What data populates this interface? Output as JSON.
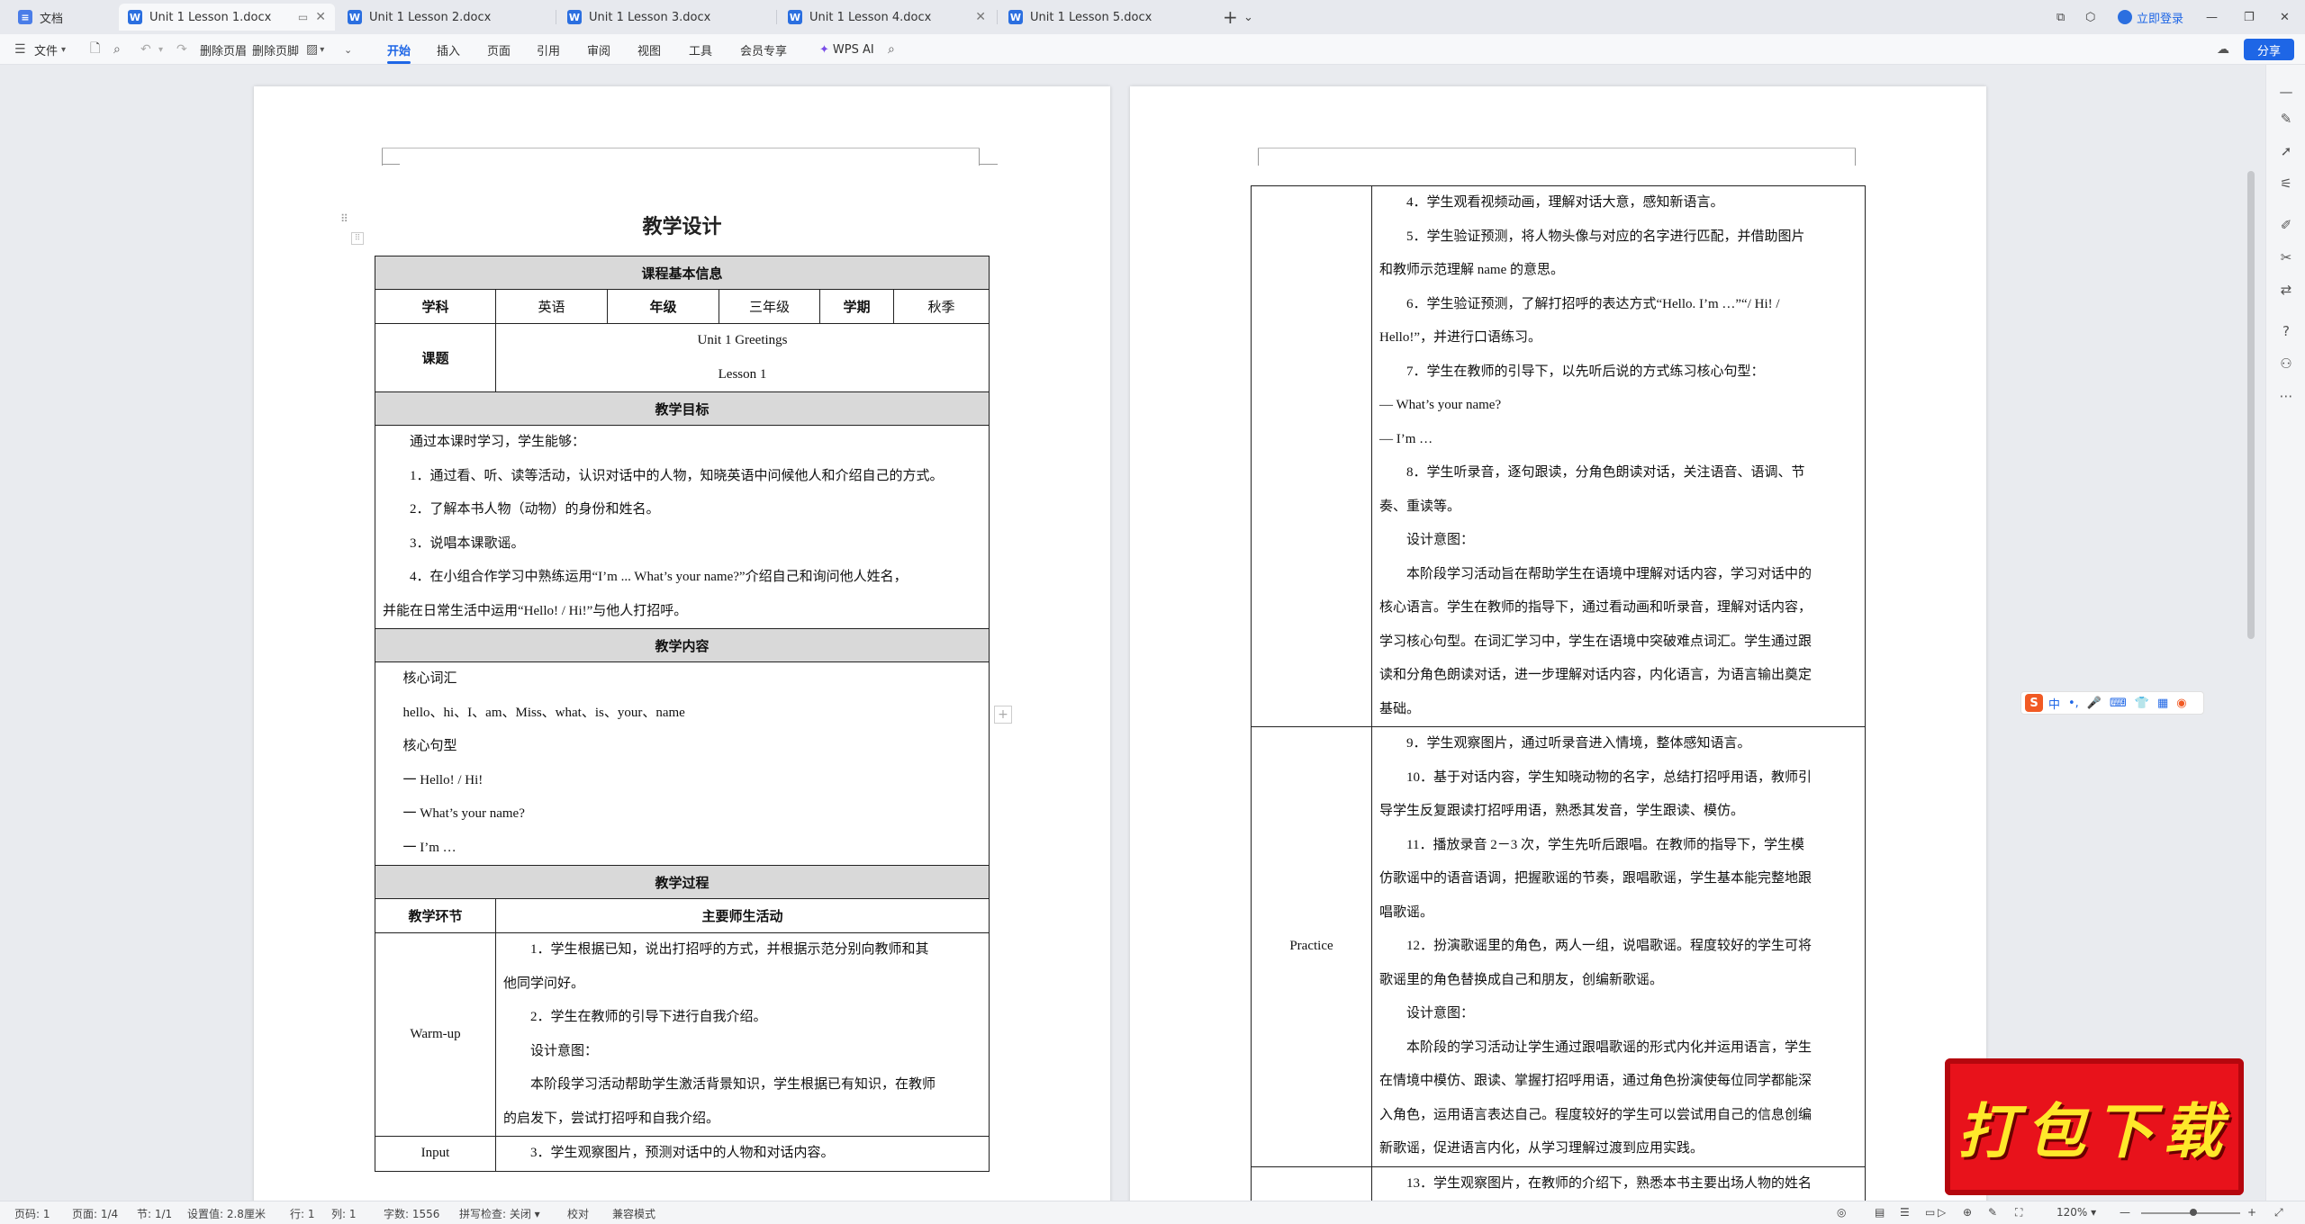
{
  "tabs": [
    {
      "label": "文档",
      "active": false
    },
    {
      "label": "Unit 1 Lesson 1.docx",
      "active": true
    },
    {
      "label": "Unit 1 Lesson 2.docx",
      "active": false
    },
    {
      "label": "Unit 1 Lesson 3.docx",
      "active": false
    },
    {
      "label": "Unit 1 Lesson 4.docx",
      "active": false
    },
    {
      "label": "Unit 1 Lesson 5.docx",
      "active": false
    }
  ],
  "titlebar": {
    "login": "立即登录",
    "share": "分享"
  },
  "ribbon": {
    "file": "文件",
    "delete_blank_page": "删除页眉",
    "delete_header": "删除页脚",
    "menus": [
      "开始",
      "插入",
      "页面",
      "引用",
      "审阅",
      "视图",
      "工具",
      "会员专享"
    ],
    "wps_ai": "WPS AI"
  },
  "page1": {
    "title": "教学设计",
    "basic_info_header": "课程基本信息",
    "subject_label": "学科",
    "subject_value": "英语",
    "grade_label": "年级",
    "grade_value": "三年级",
    "term_label": "学期",
    "term_value": "秋季",
    "topic_label": "课题",
    "topic_line1": "Unit 1 Greetings",
    "topic_line2": "Lesson 1",
    "goals_header": "教学目标",
    "goals": [
      "通过本课时学习，学生能够：",
      "1．通过看、听、读等活动，认识对话中的人物，知晓英语中问候他人和介绍自己的方式。",
      "2．了解本书人物（动物）的身份和姓名。",
      "3．说唱本课歌谣。",
      "4．在小组合作学习中熟练运用“I’m ... What’s your name?”介绍自己和询问他人姓名，",
      "并能在日常生活中运用“Hello! / Hi!”与他人打招呼。"
    ],
    "content_header": "教学内容",
    "vocab_title": "核心词汇",
    "vocab": "hello、hi、I、am、Miss、what、is、your、name",
    "pattern_title": "核心句型",
    "patterns": [
      "一  Hello! / Hi!",
      "一  What’s your name?",
      "一  I’m …"
    ],
    "process_header": "教学过程",
    "stage_col": "教学环节",
    "activity_col": "主要师生活动",
    "warmup_label": "Warm-up",
    "warmup": [
      "1．学生根据已知，说出打招呼的方式，并根据示范分别向教师和其",
      "他同学问好。",
      "2．学生在教师的引导下进行自我介绍。",
      "设计意图：",
      "本阶段学习活动帮助学生激活背景知识，学生根据已有知识，在教师",
      "的启发下，尝试打招呼和自我介绍。"
    ],
    "input_label": "Input",
    "input": "3．学生观察图片，预测对话中的人物和对话内容。"
  },
  "page2": {
    "input_cont": [
      "4．学生观看视频动画，理解对话大意，感知新语言。",
      "5．学生验证预测，将人物头像与对应的名字进行匹配，并借助图片",
      "和教师示范理解 name 的意思。",
      "6．学生验证预测，了解打招呼的表达方式“Hello. I’m …”“/ Hi! /",
      "Hello!”，并进行口语练习。",
      "7．学生在教师的引导下，以先听后说的方式练习核心句型：",
      "— What’s your name?",
      "— I’m …",
      "8．学生听录音，逐句跟读，分角色朗读对话，关注语音、语调、节",
      "奏、重读等。",
      "设计意图：",
      "本阶段学习活动旨在帮助学生在语境中理解对话内容，学习对话中的",
      "核心语言。学生在教师的指导下，通过看动画和听录音，理解对话内容，",
      "学习核心句型。在词汇学习中，学生在语境中突破难点词汇。学生通过跟",
      "读和分角色朗读对话，进一步理解对话内容，内化语言，为语言输出奠定",
      "基础。"
    ],
    "practice_label": "Practice",
    "practice": [
      "9．学生观察图片，通过听录音进入情境，整体感知语言。",
      "10．基于对话内容，学生知晓动物的名字，总结打招呼用语，教师引",
      "导学生反复跟读打招呼用语，熟悉其发音，学生跟读、模仿。",
      "11．播放录音 2－3 次，学生先听后跟唱。在教师的指导下，学生模",
      "仿歌谣中的语音语调，把握歌谣的节奏，跟唱歌谣，学生基本能完整地跟",
      "唱歌谣。",
      "12．扮演歌谣里的角色，两人一组，说唱歌谣。程度较好的学生可将",
      "歌谣里的角色替换成自己和朋友，创编新歌谣。",
      "设计意图：",
      "本阶段的学习活动让学生通过跟唱歌谣的形式内化并运用语言，学生",
      "在情境中模仿、跟读、掌握打招呼用语，通过角色扮演使每位同学都能深",
      "入角色，运用语言表达自己。程度较好的学生可以尝试用自己的信息创编",
      "新歌谣，促进语言内化，从学习理解过渡到应用实践。"
    ],
    "next_row": "13．学生观察图片，在教师的介绍下，熟悉本书主要出场人物的姓名"
  },
  "ime": {
    "mode": "中"
  },
  "download_banner": "打包下载",
  "statusbar": {
    "page": "页码: 1",
    "pages": "页面: 1/4",
    "section": "节: 1/1",
    "setting": "设置值: 2.8厘米",
    "row": "行: 1",
    "col": "列: 1",
    "words": "字数: 1556",
    "spell": "拼写检查: 关闭",
    "proof": "校对",
    "compat": "兼容模式",
    "zoom": "120%"
  }
}
